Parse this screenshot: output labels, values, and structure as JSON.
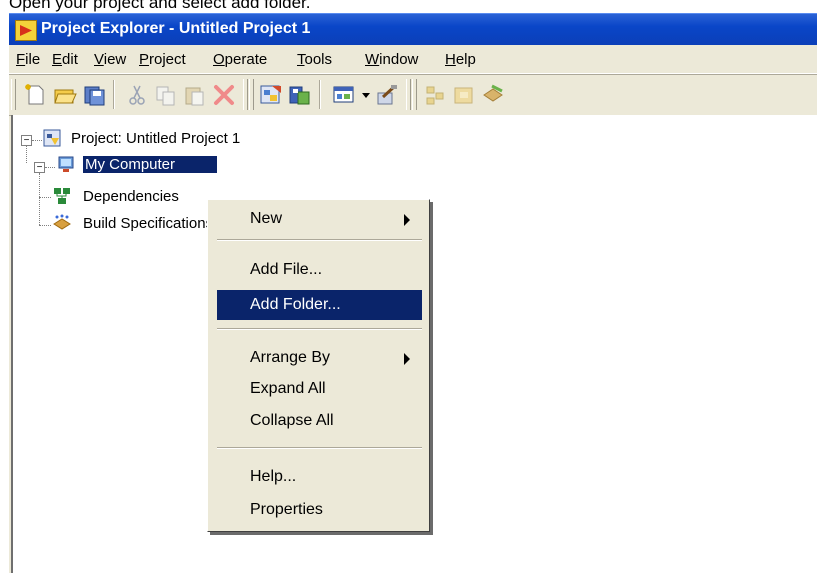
{
  "caption": "Open your project and select add folder.",
  "window": {
    "title": "Project Explorer - Untitled Project 1"
  },
  "menubar": {
    "items": [
      {
        "key": "F",
        "rest": "ile"
      },
      {
        "key": "E",
        "rest": "dit"
      },
      {
        "key": "V",
        "rest": "iew"
      },
      {
        "key": "P",
        "rest": "roject"
      },
      {
        "key": "O",
        "rest": "perate"
      },
      {
        "key": "T",
        "rest": "ools"
      },
      {
        "key": "W",
        "rest": "indow"
      },
      {
        "key": "H",
        "rest": "elp"
      }
    ]
  },
  "toolbar": {
    "icons": [
      "new-icon",
      "open-icon",
      "save-all-icon",
      "cut-icon",
      "copy-icon",
      "paste-icon",
      "delete-icon",
      "project-properties-icon",
      "build-icon",
      "view-icon",
      "dropdown-icon",
      "options-icon",
      "dependencies-icon",
      "package-icon",
      "deploy-icon"
    ]
  },
  "tree": {
    "root": "Project: Untitled Project 1",
    "my_computer": "My Computer",
    "dependencies": "Dependencies",
    "build_specs": "Build Specifications"
  },
  "context_menu": {
    "new": "New",
    "add_file": "Add File...",
    "add_folder": "Add Folder...",
    "arrange_by": "Arrange By",
    "expand_all": "Expand All",
    "collapse_all": "Collapse All",
    "help": "Help...",
    "properties": "Properties"
  },
  "colors": {
    "title_bar": "#0a46c8",
    "selection": "#0a246a",
    "menu_background": "#ece9d8"
  }
}
